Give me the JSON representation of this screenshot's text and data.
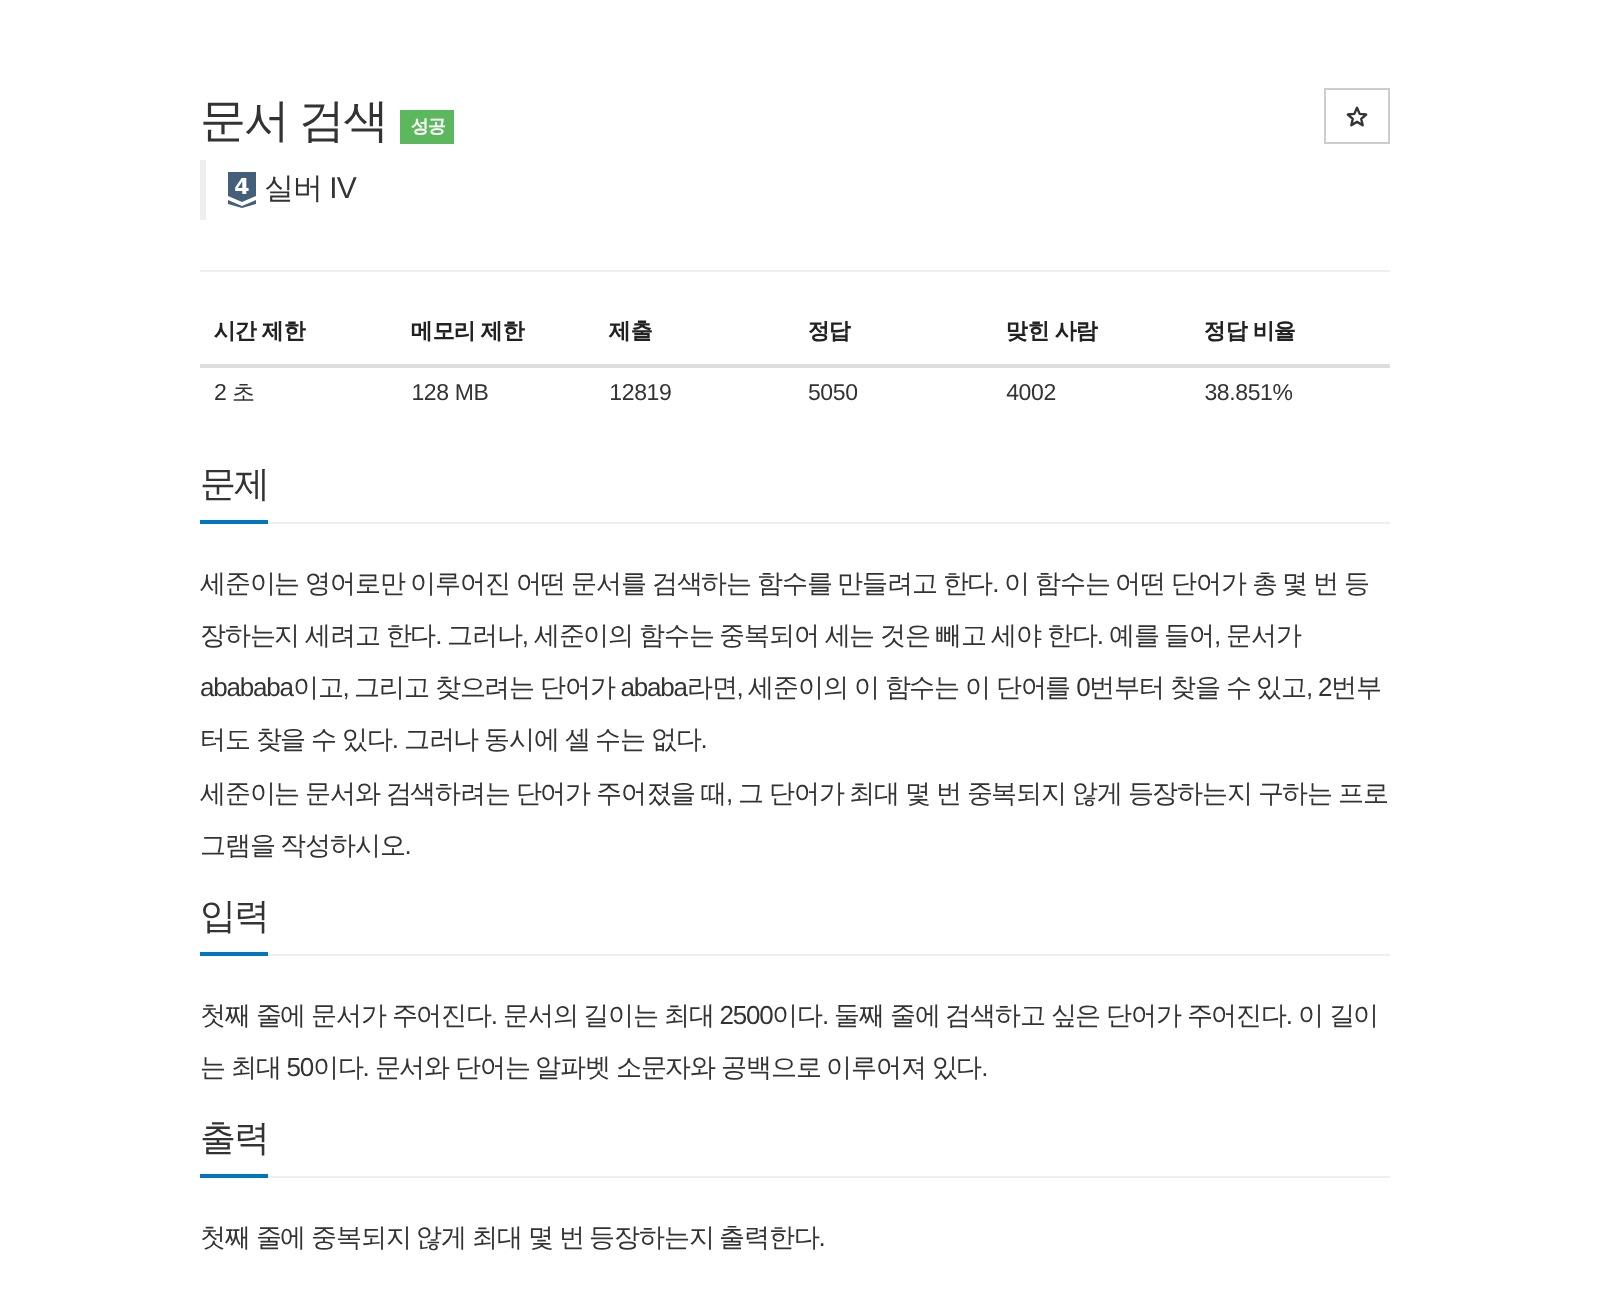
{
  "problem": {
    "title": "문서 검색",
    "badge": {
      "text": "성공",
      "kind": "success"
    },
    "starred": false,
    "tier": {
      "number": "4",
      "label": "실버 IV",
      "kind": "silver"
    }
  },
  "info_table": {
    "columns": [
      "시간 제한",
      "메모리 제한",
      "제출",
      "정답",
      "맞힌 사람",
      "정답 비율"
    ],
    "rows": [
      [
        "2 초",
        "128 MB",
        "12819",
        "5050",
        "4002",
        "38.851%"
      ]
    ]
  },
  "sections": [
    {
      "heading": "문제",
      "paragraphs": [
        "세준이는 영어로만 이루어진 어떤 문서를 검색하는 함수를 만들려고 한다. 이 함수는 어떤 단어가 총 몇 번 등장하는지 세려고 한다. 그러나, 세준이의 함수는 중복되어 세는 것은 빼고 세야 한다. 예를 들어, 문서가 abababa이고, 그리고 찾으려는 단어가 ababa라면, 세준이의 이 함수는 이 단어를 0번부터 찾을 수 있고, 2번부터도 찾을 수 있다. 그러나 동시에 셀 수는 없다.",
        "세준이는 문서와 검색하려는 단어가 주어졌을 때, 그 단어가 최대 몇 번 중복되지 않게 등장하는지 구하는 프로그램을 작성하시오."
      ]
    },
    {
      "heading": "입력",
      "paragraphs": [
        "첫째 줄에 문서가 주어진다. 문서의 길이는 최대 2500이다. 둘째 줄에 검색하고 싶은 단어가 주어진다. 이 길이는 최대 50이다. 문서와 단어는 알파벳 소문자와 공백으로 이루어져 있다."
      ]
    },
    {
      "heading": "출력",
      "paragraphs": [
        "첫째 줄에 중복되지 않게 최대 몇 번 등장하는지 출력한다."
      ]
    }
  ]
}
